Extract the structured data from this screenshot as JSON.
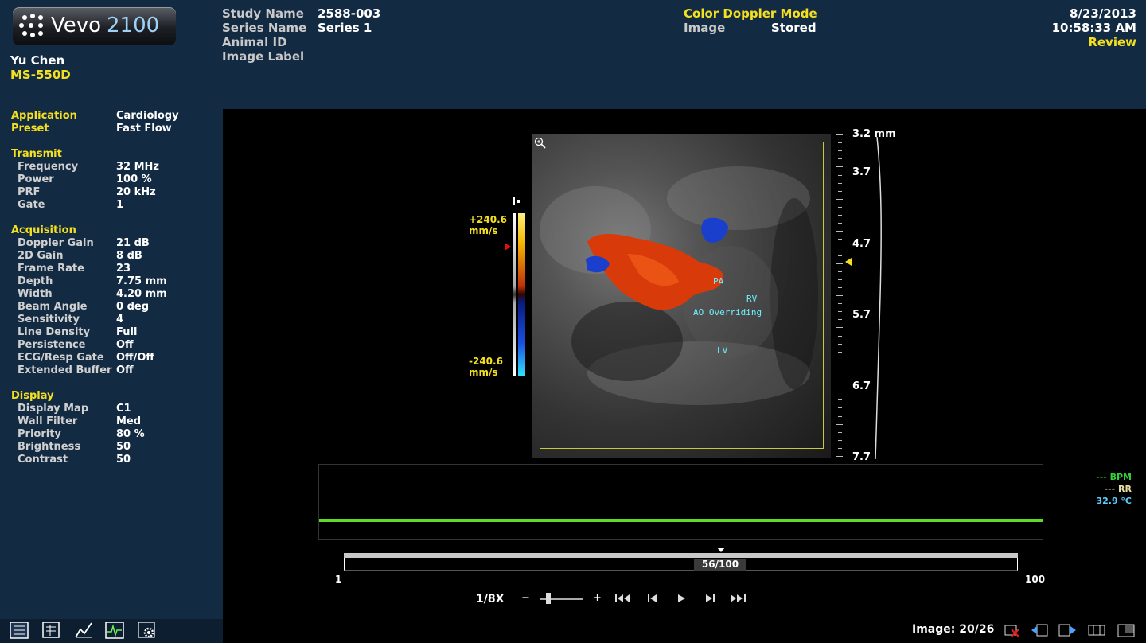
{
  "logo": {
    "brand": "Vevo",
    "model": "2100"
  },
  "user": {
    "name": "Yu Chen",
    "transducer": "MS-550D"
  },
  "study": {
    "labels": [
      "Study Name",
      "Series Name",
      "Animal ID",
      "Image Label"
    ],
    "values": [
      "2588-003",
      "Series 1",
      "",
      ""
    ]
  },
  "mode": {
    "title": "Color Doppler Mode",
    "image_label": "Image",
    "image_value": "Stored"
  },
  "datetime": {
    "date": "8/23/2013",
    "time": "10:58:33 AM",
    "status": "Review"
  },
  "params": {
    "application": {
      "label": "Application",
      "value": "Cardiology"
    },
    "preset": {
      "label": "Preset",
      "value": "Fast Flow"
    },
    "transmit_title": "Transmit",
    "transmit": [
      {
        "label": "Frequency",
        "value": "32 MHz"
      },
      {
        "label": "Power",
        "value": "100 %"
      },
      {
        "label": "PRF",
        "value": "20 kHz"
      },
      {
        "label": "Gate",
        "value": "1"
      }
    ],
    "acquisition_title": "Acquisition",
    "acquisition": [
      {
        "label": "Doppler Gain",
        "value": "21 dB"
      },
      {
        "label": "2D Gain",
        "value": "8 dB"
      },
      {
        "label": "Frame Rate",
        "value": "23"
      },
      {
        "label": "Depth",
        "value": "7.75 mm"
      },
      {
        "label": "Width",
        "value": "4.20 mm"
      },
      {
        "label": "Beam Angle",
        "value": "0 deg"
      },
      {
        "label": "Sensitivity",
        "value": "4"
      },
      {
        "label": "Line Density",
        "value": "Full"
      },
      {
        "label": "Persistence",
        "value": "Off"
      },
      {
        "label": "ECG/Resp Gate",
        "value": "Off/Off"
      },
      {
        "label": "Extended Buffer",
        "value": "Off"
      }
    ],
    "display_title": "Display",
    "display": [
      {
        "label": "Display Map",
        "value": "C1"
      },
      {
        "label": "Wall Filter",
        "value": "Med"
      },
      {
        "label": "Priority",
        "value": "80 %"
      },
      {
        "label": "Brightness",
        "value": "50"
      },
      {
        "label": "Contrast",
        "value": "50"
      }
    ]
  },
  "colorbar": {
    "max": "+240.6",
    "min": "-240.6",
    "unit": "mm/s"
  },
  "depth_scale": {
    "top": "3.2 mm",
    "labels": [
      "3.7",
      "4.7",
      "5.7",
      "6.7",
      "7.7"
    ]
  },
  "annotations": {
    "pa": "PA",
    "rv": "RV",
    "ao": "AO Overriding",
    "lv": "LV"
  },
  "vitals": {
    "bpm": "--- BPM",
    "rr": "--- RR",
    "temp": "32.9 °C"
  },
  "timeline": {
    "start": "1",
    "end": "100",
    "frame": "56/100",
    "frame_fraction": 0.56
  },
  "playback": {
    "speed": "1/8X",
    "zoom_out": "−",
    "zoom_in": "+"
  },
  "image_counter": "Image: 20/26"
}
